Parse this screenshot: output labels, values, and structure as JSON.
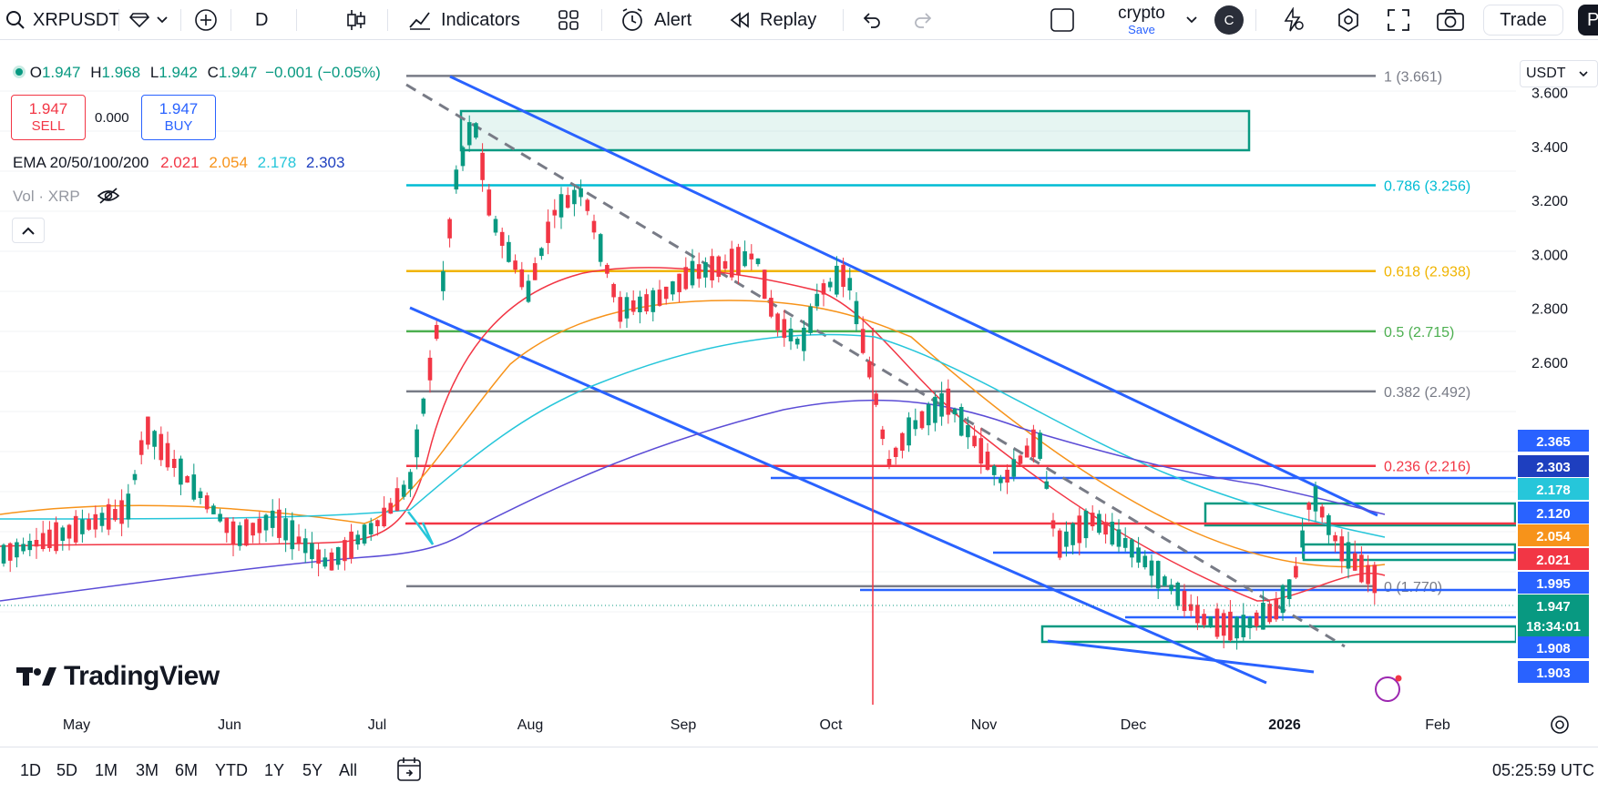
{
  "toolbar": {
    "symbol": "XRPUSDT",
    "interval": "D",
    "indicators_label": "Indicators",
    "alert_label": "Alert",
    "replay_label": "Replay",
    "layout_name": "crypto",
    "layout_save": "Save",
    "avatar_letter": "C",
    "trade_label": "Trade",
    "publish_letter": "P"
  },
  "legend": {
    "o_label": "O",
    "o": "1.947",
    "h_label": "H",
    "h": "1.968",
    "l_label": "L",
    "l": "1.942",
    "c_label": "C",
    "c": "1.947",
    "change": "−0.001 (−0.05%)",
    "sell_price": "1.947",
    "sell_label": "SELL",
    "spread": "0.000",
    "buy_price": "1.947",
    "buy_label": "BUY",
    "ema_label": "EMA 20/50/100/200",
    "ema20": "2.021",
    "ema50": "2.054",
    "ema100": "2.178",
    "ema200": "2.303",
    "vol_label": "Vol · XRP",
    "collapse_icon": "chevron-up-icon"
  },
  "axis": {
    "currency": "USDT",
    "ticks": [
      "3.600",
      "3.400",
      "3.200",
      "3.000",
      "2.800",
      "2.600"
    ],
    "price_labels": [
      {
        "value": "2.365",
        "color": "#2962ff"
      },
      {
        "value": "2.303",
        "color": "#1e3fbf"
      },
      {
        "value": "2.178",
        "color": "#26c6da"
      },
      {
        "value": "2.120",
        "color": "#2962ff"
      },
      {
        "value": "2.054",
        "color": "#f7931a"
      },
      {
        "value": "2.021",
        "color": "#f23645"
      },
      {
        "value": "1.995",
        "color": "#2962ff"
      },
      {
        "value": "1.947",
        "color": "#089981"
      },
      {
        "value": "18:34:01",
        "color": "#089981"
      },
      {
        "value": "1.908",
        "color": "#2962ff"
      },
      {
        "value": "1.903",
        "color": "#2962ff"
      }
    ]
  },
  "fib": [
    {
      "label": "1 (3.661)",
      "color": "#787b86"
    },
    {
      "label": "0.786 (3.256)",
      "color": "#00bcd4"
    },
    {
      "label": "0.618 (2.938)",
      "color": "#f0b400"
    },
    {
      "label": "0.5 (2.715)",
      "color": "#4caf50"
    },
    {
      "label": "0.382 (2.492)",
      "color": "#787b86"
    },
    {
      "label": "0.236 (2.216)",
      "color": "#f23645"
    },
    {
      "label": "0 (1.770)",
      "color": "#787b86"
    }
  ],
  "time_axis": [
    "May",
    "Jun",
    "Jul",
    "Aug",
    "Sep",
    "Oct",
    "Nov",
    "Dec",
    "2026",
    "Feb"
  ],
  "ranges": [
    "1D",
    "5D",
    "1M",
    "3M",
    "6M",
    "YTD",
    "1Y",
    "5Y",
    "All"
  ],
  "clock": "05:25:59 UTC",
  "watermark": "TradingView",
  "colors": {
    "up": "#089981",
    "down": "#f23645",
    "channel": "#2962ff"
  }
}
